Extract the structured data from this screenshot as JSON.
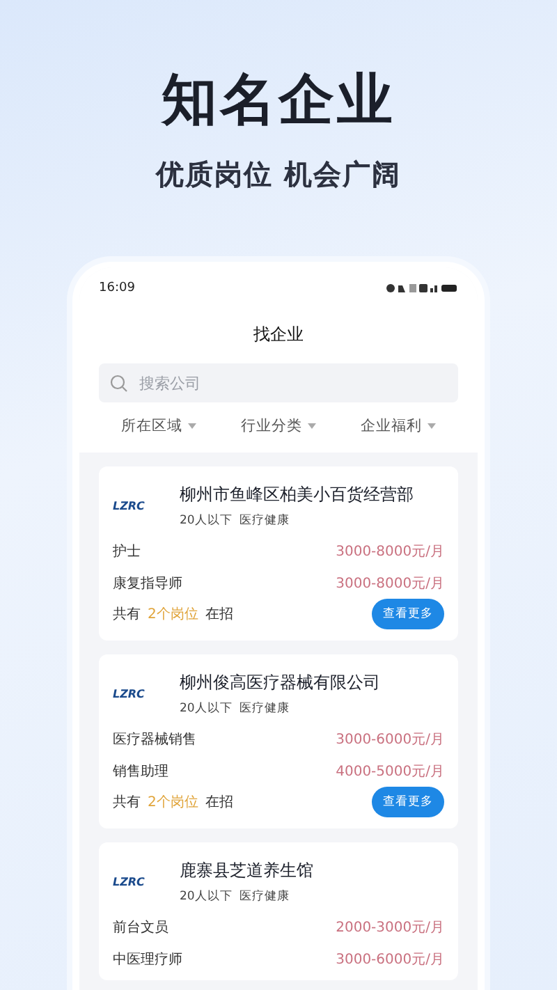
{
  "headline": "知名企业",
  "subtitle": "优质岗位 机会广阔",
  "status_bar": {
    "time": "16:09"
  },
  "page_title": "找企业",
  "search": {
    "placeholder": "搜索公司"
  },
  "filters": [
    {
      "label": "所在区域"
    },
    {
      "label": "行业分类"
    },
    {
      "label": "企业福利"
    }
  ],
  "companies": [
    {
      "logo": "LZRC",
      "name": "柳州市鱼峰区柏美小百货经营部",
      "size": "20人以下",
      "industry": "医疗健康",
      "jobs": [
        {
          "title": "护士",
          "salary": "3000-8000元/月"
        },
        {
          "title": "康复指导师",
          "salary": "3000-8000元/月"
        }
      ],
      "footer": {
        "prefix": "共有",
        "count": "2个岗位",
        "suffix": "在招",
        "button": "查看更多"
      }
    },
    {
      "logo": "LZRC",
      "name": "柳州俊高医疗器械有限公司",
      "size": "20人以下",
      "industry": "医疗健康",
      "jobs": [
        {
          "title": "医疗器械销售",
          "salary": "3000-6000元/月"
        },
        {
          "title": "销售助理",
          "salary": "4000-5000元/月"
        }
      ],
      "footer": {
        "prefix": "共有",
        "count": "2个岗位",
        "suffix": "在招",
        "button": "查看更多"
      }
    },
    {
      "logo": "LZRC",
      "name": "鹿寨县芝道养生馆",
      "size": "20人以下",
      "industry": "医疗健康",
      "jobs": [
        {
          "title": "前台文员",
          "salary": "2000-3000元/月"
        },
        {
          "title": "中医理疗师",
          "salary": "3000-6000元/月"
        }
      ]
    }
  ]
}
